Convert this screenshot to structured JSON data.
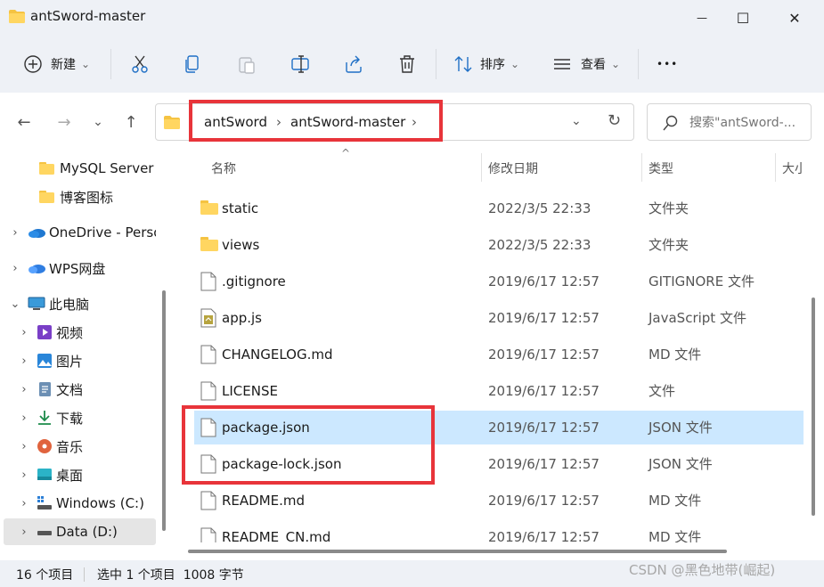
{
  "window": {
    "title": "antSword-master",
    "minimize_glyph": "—",
    "maximize_glyph": "☐",
    "close_glyph": "✕"
  },
  "toolbar": {
    "new_label": "新建",
    "sort_label": "排序",
    "view_label": "查看",
    "more_glyph": "•••",
    "dropdown_glyph": "⌄"
  },
  "nav": {
    "back_glyph": "←",
    "forward_glyph": "→",
    "recent_glyph": "⌄",
    "up_glyph": "↑"
  },
  "address": {
    "crumbs": [
      "antSword",
      "antSword-master"
    ],
    "separator": "›",
    "dropdown_glyph": "⌄",
    "refresh_glyph": "↻"
  },
  "search": {
    "placeholder": "搜索\"antSword-..."
  },
  "sidebar": {
    "items": [
      {
        "label": "MySQL Server",
        "icon": "folder-icon"
      },
      {
        "label": "博客图标",
        "icon": "folder-icon"
      },
      {
        "label": "OneDrive - Perso",
        "icon": "onedrive-cloud-icon"
      },
      {
        "label": "WPS网盘",
        "icon": "wps-cloud-icon"
      },
      {
        "label": "此电脑",
        "icon": "computer-icon"
      },
      {
        "label": "视频",
        "icon": "video-icon"
      },
      {
        "label": "图片",
        "icon": "picture-icon"
      },
      {
        "label": "文档",
        "icon": "document-icon"
      },
      {
        "label": "下载",
        "icon": "download-icon"
      },
      {
        "label": "音乐",
        "icon": "music-icon"
      },
      {
        "label": "桌面",
        "icon": "desktop-icon"
      },
      {
        "label": "Windows (C:)",
        "icon": "drive-c-icon"
      },
      {
        "label": "Data (D:)",
        "icon": "drive-d-icon"
      }
    ],
    "chevron_right": "›",
    "chevron_down": "⌄"
  },
  "columns": {
    "name": "名称",
    "date": "修改日期",
    "type": "类型",
    "size": "大小",
    "sort_glyph": "^"
  },
  "files": [
    {
      "name": "static",
      "date": "2022/3/5 22:33",
      "type": "文件夹",
      "icon": "folder-icon"
    },
    {
      "name": "views",
      "date": "2022/3/5 22:33",
      "type": "文件夹",
      "icon": "folder-icon"
    },
    {
      "name": ".gitignore",
      "date": "2019/6/17 12:57",
      "type": "GITIGNORE 文件",
      "icon": "file-icon"
    },
    {
      "name": "app.js",
      "date": "2019/6/17 12:57",
      "type": "JavaScript 文件",
      "icon": "js-file-icon"
    },
    {
      "name": "CHANGELOG.md",
      "date": "2019/6/17 12:57",
      "type": "MD 文件",
      "icon": "file-icon"
    },
    {
      "name": "LICENSE",
      "date": "2019/6/17 12:57",
      "type": "文件",
      "icon": "file-icon"
    },
    {
      "name": "package.json",
      "date": "2019/6/17 12:57",
      "type": "JSON 文件",
      "icon": "file-icon",
      "selected": true
    },
    {
      "name": "package-lock.json",
      "date": "2019/6/17 12:57",
      "type": "JSON 文件",
      "icon": "file-icon"
    },
    {
      "name": "README.md",
      "date": "2019/6/17 12:57",
      "type": "MD 文件",
      "icon": "file-icon"
    },
    {
      "name": "README_CN.md",
      "date": "2019/6/17 12:57",
      "type": "MD 文件",
      "icon": "file-icon"
    }
  ],
  "status": {
    "item_count": "16 个项目",
    "selection": "选中 1 个项目  1008 字节"
  },
  "watermark": "CSDN @黑色地带(崛起)",
  "colors": {
    "selection_bg": "#cce8ff",
    "highlight_red": "#e8343a",
    "folder_yellow": "#f5c342"
  }
}
